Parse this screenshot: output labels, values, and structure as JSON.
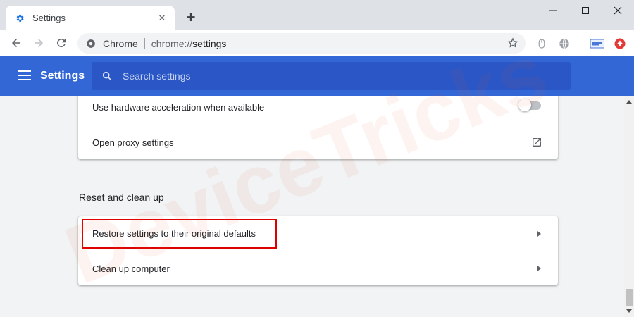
{
  "tab": {
    "title": "Settings",
    "favicon": "gear-icon",
    "close": "✕"
  },
  "new_tab": "+",
  "window": {
    "minimize": "minimize-icon",
    "maximize": "maximize-icon",
    "close": "close-icon"
  },
  "toolbar": {
    "site_label": "Chrome",
    "url_prefix": "chrome://",
    "url_path": "settings"
  },
  "header": {
    "title": "Settings",
    "search_placeholder": "Search settings"
  },
  "system_card": {
    "rows": [
      {
        "label": "Use hardware acceleration when available",
        "control": "toggle",
        "checked": false
      },
      {
        "label": "Open proxy settings",
        "control": "external-link-icon"
      }
    ]
  },
  "reset_section": {
    "title": "Reset and clean up",
    "rows": [
      {
        "label": "Restore settings to their original defaults",
        "control": "arrow-right-icon"
      },
      {
        "label": "Clean up computer",
        "control": "arrow-right-icon"
      }
    ]
  },
  "watermark": {
    "text": "DeviceTricks"
  },
  "colors": {
    "header": "#3367d6",
    "search_bg": "#2a56c6",
    "highlight": "#e00000",
    "accent": "#1a73e8"
  }
}
